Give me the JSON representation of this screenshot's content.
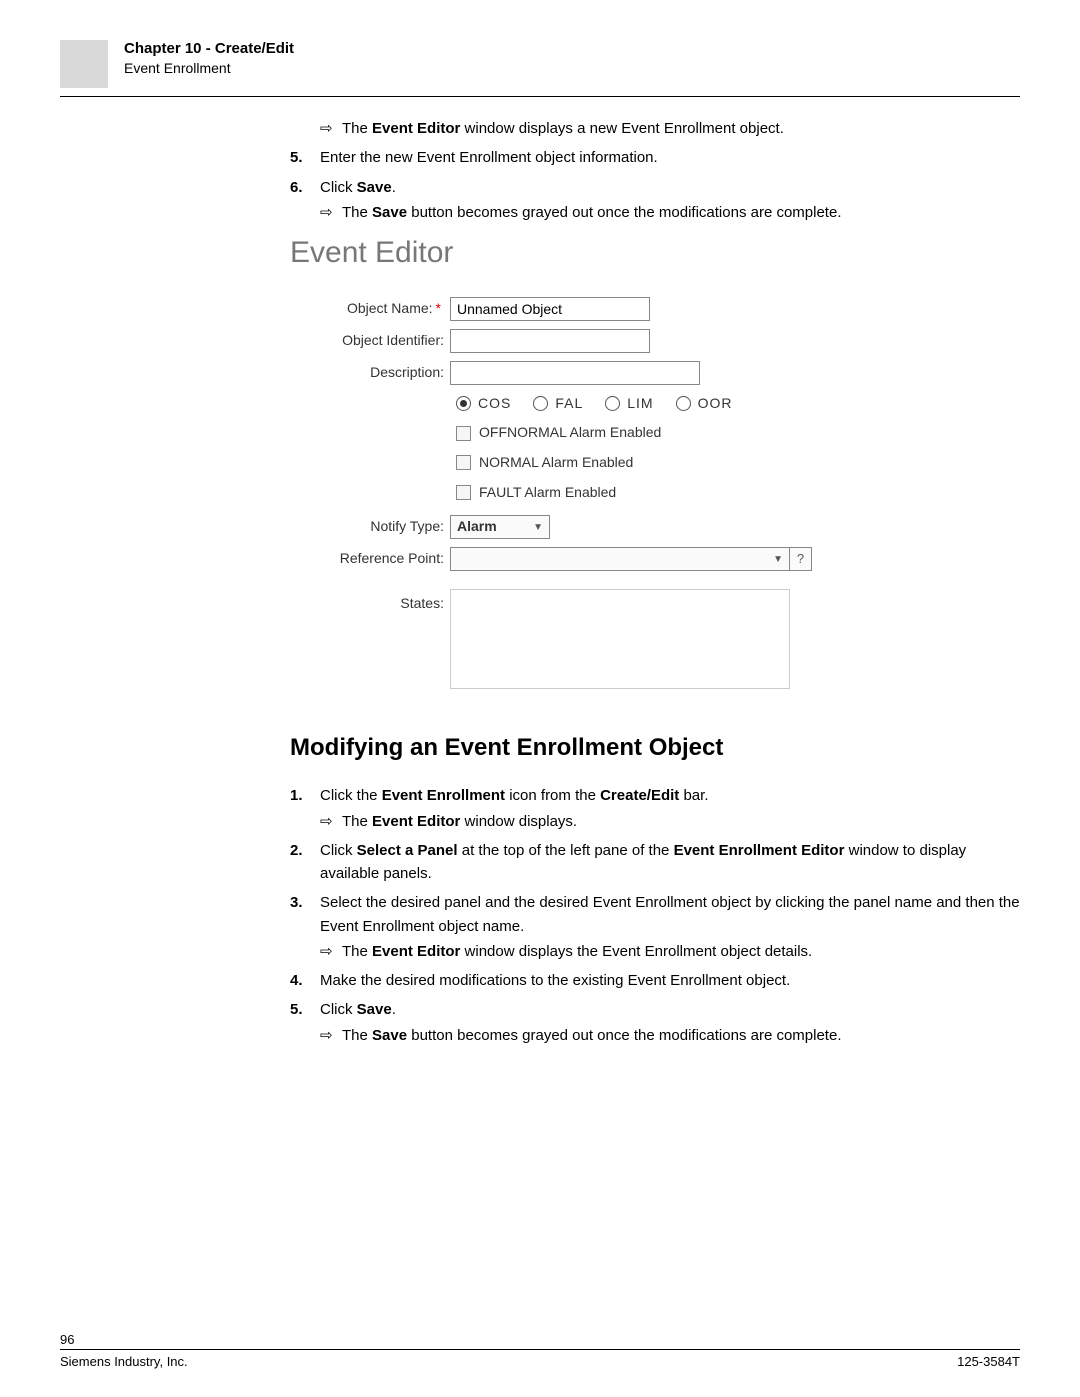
{
  "header": {
    "chapter": "Chapter 10 - Create/Edit",
    "section": "Event Enrollment"
  },
  "intro": {
    "r1_pre": "The ",
    "r1_b": "Event Editor",
    "r1_post": " window displays a new Event Enrollment object.",
    "step5_num": "5.",
    "step5_txt": "Enter the new Event Enrollment object information.",
    "step6_num": "6.",
    "step6_pre": "Click ",
    "step6_b": "Save",
    "step6_post": ".",
    "r2_pre": "The ",
    "r2_b": "Save",
    "r2_post": " button becomes grayed out once the modifications are complete."
  },
  "editor": {
    "title": "Event Editor",
    "labels": {
      "object_name": "Object Name:",
      "object_id": "Object Identifier:",
      "description": "Description:",
      "notify_type": "Notify Type:",
      "reference_point": "Reference Point:",
      "states": "States:"
    },
    "object_name_value": "Unnamed Object",
    "radios": {
      "cos": "COS",
      "fal": "FAL",
      "lim": "LIM",
      "oor": "OOR"
    },
    "checks": {
      "offnormal": "OFFNORMAL Alarm Enabled",
      "normal": "NORMAL Alarm Enabled",
      "fault": "FAULT Alarm Enabled"
    },
    "notify_type_value": "Alarm",
    "ref_help": "?"
  },
  "section2": {
    "title": "Modifying an Event Enrollment Object",
    "s1_num": "1.",
    "s1_pre": "Click the ",
    "s1_b1": "Event Enrollment",
    "s1_mid": " icon from the ",
    "s1_b2": "Create/Edit",
    "s1_post": " bar.",
    "s1_r_pre": "The ",
    "s1_r_b": "Event Editor",
    "s1_r_post": " window displays.",
    "s2_num": "2.",
    "s2_pre": "Click ",
    "s2_b1": "Select a Panel",
    "s2_mid": " at the top of the left pane of the ",
    "s2_b2": "Event Enrollment Editor",
    "s2_post": " window to display available panels.",
    "s3_num": "3.",
    "s3_txt": "Select the desired panel and the desired Event Enrollment object by clicking the panel name and then the Event Enrollment object name.",
    "s3_r_pre": "The ",
    "s3_r_b": "Event Editor",
    "s3_r_post": " window displays the Event Enrollment object details.",
    "s4_num": "4.",
    "s4_txt": "Make the desired modifications to the existing Event Enrollment object.",
    "s5_num": "5.",
    "s5_pre": "Click ",
    "s5_b": "Save",
    "s5_post": ".",
    "s5_r_pre": "The ",
    "s5_r_b": "Save",
    "s5_r_post": " button becomes grayed out once the modifications are complete."
  },
  "footer": {
    "page": "96",
    "left": "Siemens Industry, Inc.",
    "right": "125-3584T"
  }
}
